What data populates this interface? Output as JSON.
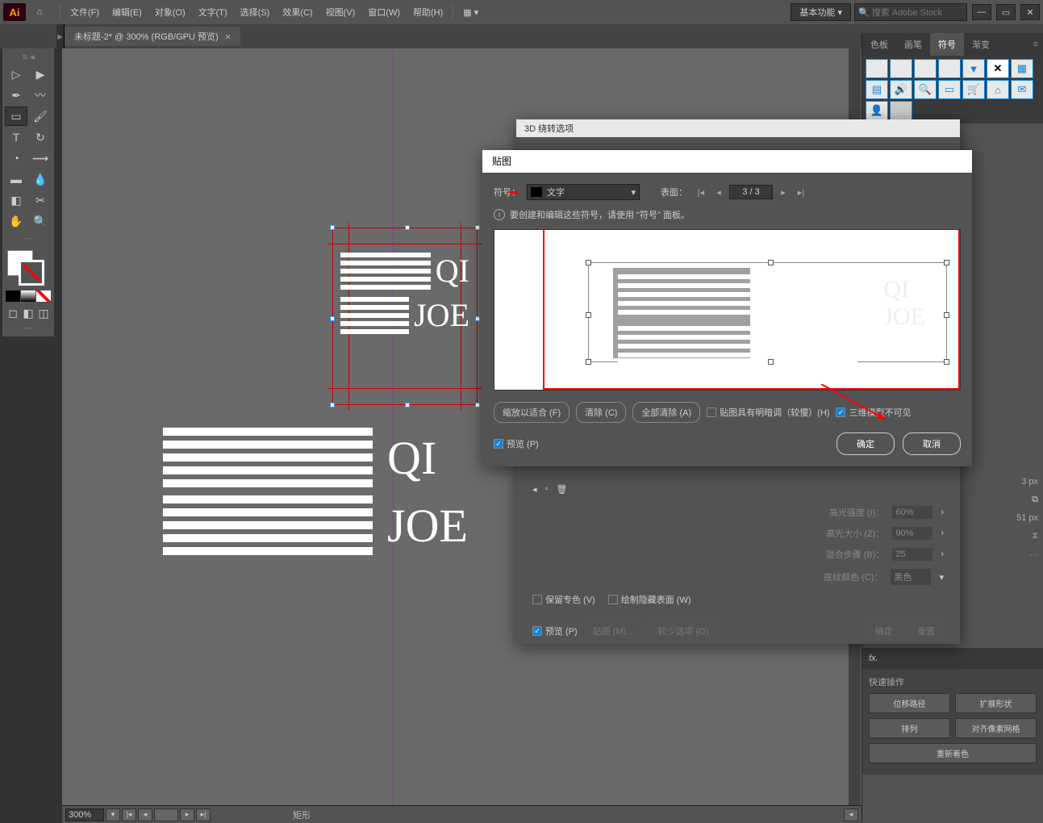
{
  "app": {
    "logo": "Ai"
  },
  "menu": [
    "文件(F)",
    "编辑(E)",
    "对象(O)",
    "文字(T)",
    "选择(S)",
    "效果(C)",
    "视图(V)",
    "窗口(W)",
    "帮助(H)"
  ],
  "workspace": "基本功能",
  "search_placeholder": "🔍 搜索 Adobe Stock",
  "doc_tab": "未标题-2* @ 300% (RGB/GPU 预览)",
  "right_tabs": [
    "色板",
    "画笔",
    "符号",
    "渐变"
  ],
  "fx": "fx.",
  "quick": {
    "title": "快速操作",
    "btns": [
      "位移路径",
      "扩展形状",
      "排列",
      "对齐像素网格",
      "重新着色"
    ]
  },
  "status": {
    "zoom": "300%",
    "tool": "矩形"
  },
  "artwork": {
    "line1": "QI",
    "line2": "JOE"
  },
  "dlg3d_title": "3D 绕转选项",
  "dlg_map": {
    "title": "贴图",
    "symbol_label": "符号：",
    "symbol_val": "文字",
    "surface_label": "表面：",
    "surface_val": "3 / 3",
    "info": "要创建和编辑这些符号，请使用 \"符号\" 面板。",
    "scale_btn": "缩放以适合 (F)",
    "clear_btn": "清除 (C)",
    "clear_all_btn": "全部清除 (A)",
    "shade_cb": "贴图具有明暗调（较慢）(H)",
    "invisible_cb": "三维模型不可见",
    "preview_cb": "预览 (P)",
    "ok": "确定",
    "cancel": "取消"
  },
  "under": {
    "highlight_intensity": "高光强度 (I)：",
    "hi_val": "60%",
    "highlight_size": "高光大小 (Z)：",
    "hs_val": "90%",
    "blend_steps": "混合步骤 (B)：",
    "bs_val": "25",
    "shade_color": "底纹颜色 (C)：",
    "sc_val": "黑色",
    "preserve": "保留专色 (V)",
    "draw_hidden": "绘制隐藏表面 (W)",
    "preview": "预览 (P)",
    "map": "贴图 (M)...",
    "fewer": "较少选项 (O)",
    "ok": "确定",
    "reset": "重置"
  },
  "px1": "3 px",
  "px2": "51 px"
}
